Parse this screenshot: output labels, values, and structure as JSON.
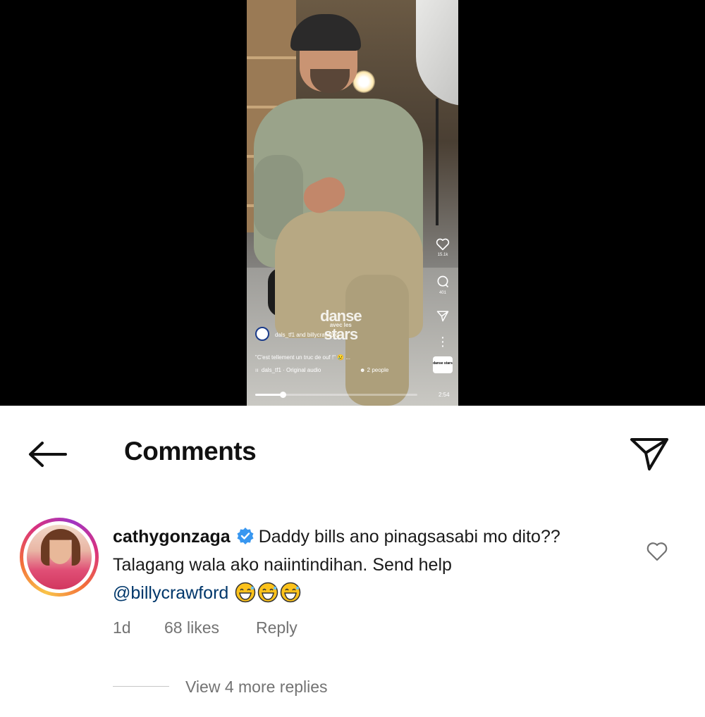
{
  "video": {
    "owner_line": "dals_tf1 and billycrawford",
    "caption": "\"C'est tellement un truc de ouf !\" 😢 ...",
    "audio": "dals_tf1 · Original audio",
    "people": "2 people",
    "watermark_top": "danse",
    "watermark_mid": "avec les",
    "watermark_bottom": "stars",
    "music_tile": "danse stars",
    "likes_count": "15.1k",
    "comments_count": "401",
    "duration": "2:54",
    "progress": 0.17
  },
  "header": {
    "title": "Comments"
  },
  "comment": {
    "username": "cathygonzaga",
    "text": "Daddy bills ano pinagsasabi mo dito?? Talagang wala ako naiintindihan. Send help",
    "mention": "@billycrawford",
    "time": "1d",
    "likes": "68 likes",
    "reply_label": "Reply",
    "view_replies": "View 4 more replies"
  },
  "colors": {
    "verified_blue": "#3897f0",
    "mention_blue": "#00376b",
    "meta_gray": "#737373"
  },
  "icons": {
    "back": "arrow-left-icon",
    "send": "paper-plane-icon",
    "like": "heart-outline-icon",
    "verified": "verified-badge-icon",
    "emoji": "grinning-sweat-emoji"
  }
}
